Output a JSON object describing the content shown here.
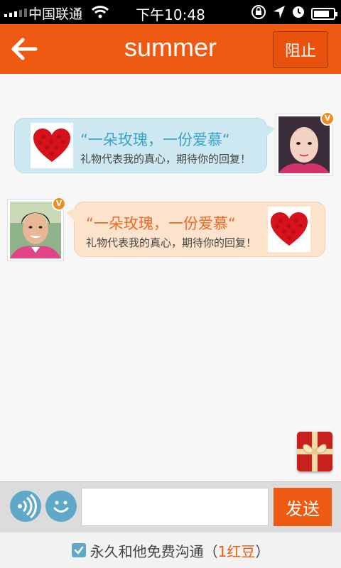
{
  "status_bar": {
    "carrier": "中国联通",
    "time": "下午10:48"
  },
  "header": {
    "title": "summer",
    "block_label": "阻止"
  },
  "messages": [
    {
      "side": "right",
      "headline": "“一朵玫瑰，一份爱慕“",
      "subtext": "礼物代表我的真心，期待你的回复！",
      "badge": "V"
    },
    {
      "side": "left",
      "headline": "“一朵玫瑰，一份爱慕“",
      "subtext": "礼物代表我的真心，期待你的回复！",
      "badge": "V"
    }
  ],
  "input_bar": {
    "message_value": "",
    "send_label": "发送"
  },
  "footer": {
    "checked": true,
    "text": "永久和他免费沟通（",
    "highlight": "1红豆",
    "suffix": "）"
  },
  "colors": {
    "brand": "#ee5a12",
    "accent_blue": "#5fa9c8"
  },
  "icons": [
    "back-arrow-icon",
    "voice-icon",
    "smiley-icon",
    "gift-box-icon",
    "heart-rose-icon",
    "verified-badge-icon",
    "wifi-icon",
    "lock-rotation-icon",
    "location-icon",
    "alarm-icon",
    "battery-icon"
  ]
}
